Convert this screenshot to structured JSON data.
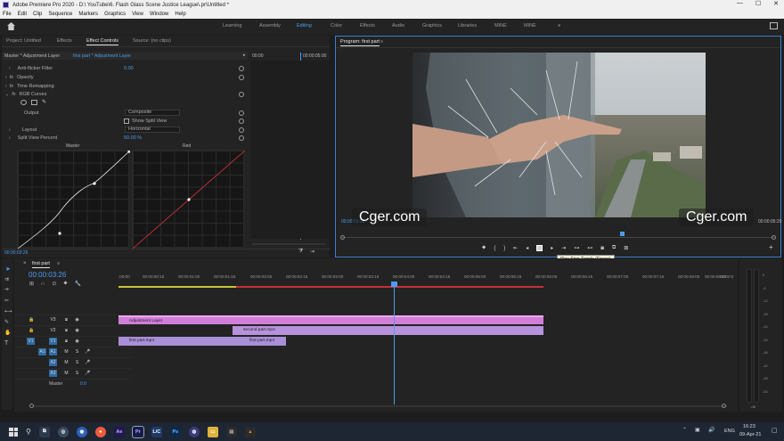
{
  "window": {
    "title": "Adobe Premiere Pro 2020 - D:\\ YouTube\\6. Flash Glass Scene Justice League\\.pr\\Untitled *",
    "minimize": "—",
    "maximize": "☐",
    "close": "✕"
  },
  "menu": [
    "File",
    "Edit",
    "Clip",
    "Sequence",
    "Markers",
    "Graphics",
    "View",
    "Window",
    "Help"
  ],
  "workspaces": [
    "Learning",
    "Assembly",
    "Editing",
    "Color",
    "Effects",
    "Audio",
    "Graphics",
    "Libraries",
    "MINE",
    "MINE"
  ],
  "active_workspace": "Editing",
  "left_tabs": [
    "Project: Untitled",
    "Effects",
    "Effect Controls",
    "Source: (no clips)"
  ],
  "effect_controls": {
    "master": "Master * Adjustment Layer",
    "clip": "first part * Adjustment Layer",
    "time": "00:00",
    "time_end": "00:00:05:00",
    "anti_flicker_label": "Anti-flicker Filter",
    "anti_flicker_value": "0.00",
    "opacity": "Opacity",
    "time_remap": "Time Remapping",
    "rgb_curves": "RGB Curves",
    "output_label": "Output",
    "output_value": "Composite",
    "show_split": "Show Split View",
    "layout_label": "Layout",
    "layout_value": "Horizontal",
    "split_label": "Split View Percent",
    "split_value": "50.00 %",
    "master_curve": "Master",
    "red_curve": "Red",
    "timecode": "00:00:03:26"
  },
  "program": {
    "title": "Program: first part",
    "tc_left": "00:00:03:26",
    "tc_right": "00:00:05:29"
  },
  "watermark": "Cger.com",
  "tooltip": "Play-Stop Toggle (Space)",
  "timeline": {
    "sequence": "first part",
    "timecode": "00:00:03:26",
    "ruler": [
      ":00:00",
      "00:00:00:15",
      "00:00:01:00",
      "00:00:01:15",
      "00:00:02:00",
      "00:00:02:15",
      "00:00:03:00",
      "00:00:03:15",
      "00:00:04:00",
      "00:00:04:15",
      "00:00:05:00",
      "00:00:05:15",
      "00:00:06:00",
      "00:00:06:15",
      "00:00:07:00",
      "00:00:07:15",
      "00:00:08:00",
      "00:00:08:15",
      "00:00:09:0"
    ],
    "tracks": [
      "V3",
      "V2",
      "V1",
      "A1",
      "A2",
      "A3",
      "Master"
    ],
    "v1_source": "V1",
    "a1_source": "A1",
    "master_value": "0.0",
    "clips": {
      "adjustment": "Adjustment Layer",
      "second": "second part.mp4",
      "first_a": "first part.mp4",
      "first_b": "first part.mp4"
    },
    "playhead_progress": 0.445
  },
  "meter": {
    "labels": [
      "0",
      "-6",
      "-12",
      "-18",
      "-24",
      "-30",
      "-36",
      "-42",
      "-48",
      "-54"
    ],
    "bottom": "-dB"
  },
  "taskbar": {
    "lang": "ENG",
    "time": "16:23",
    "date": "09-Apr-21"
  }
}
